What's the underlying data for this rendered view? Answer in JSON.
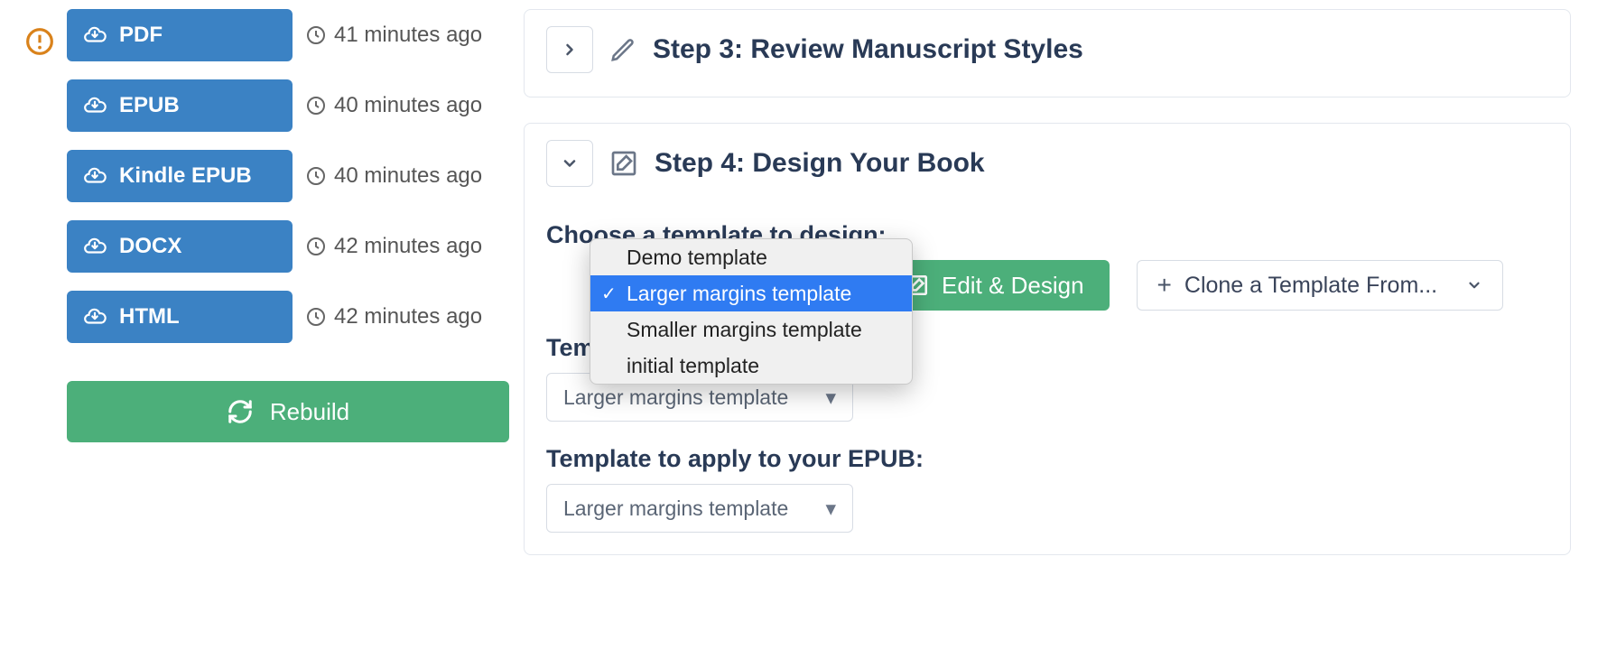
{
  "sidebar": {
    "formats": [
      {
        "label": "PDF",
        "time": "41 minutes ago"
      },
      {
        "label": "EPUB",
        "time": "40 minutes ago"
      },
      {
        "label": "Kindle EPUB",
        "time": "40 minutes ago"
      },
      {
        "label": "DOCX",
        "time": "42 minutes ago"
      },
      {
        "label": "HTML",
        "time": "42 minutes ago"
      }
    ],
    "rebuild_label": "Rebuild",
    "alert_icon": "warning-circle"
  },
  "step3": {
    "title": "Step 3: Review Manuscript Styles",
    "expanded": false
  },
  "step4": {
    "title": "Step 4: Design Your Book",
    "expanded": true,
    "choose_label": "Choose a template to design:",
    "template_options": [
      "Demo template",
      "Larger margins template",
      "Smaller margins template",
      "initial template"
    ],
    "template_selected": "Larger margins template",
    "edit_design_label": "Edit & Design",
    "clone_label": "Clone a Template From...",
    "pdf_label": "Template to apply to your PDF:",
    "pdf_selected": "Larger margins template",
    "epub_label": "Template to apply to your EPUB:",
    "epub_selected": "Larger margins template"
  },
  "colors": {
    "blue_btn": "#3b82c4",
    "green_btn": "#4caf7a",
    "heading": "#293a56",
    "warning": "#d9821b",
    "dropdown_highlight": "#2f7bf2"
  }
}
